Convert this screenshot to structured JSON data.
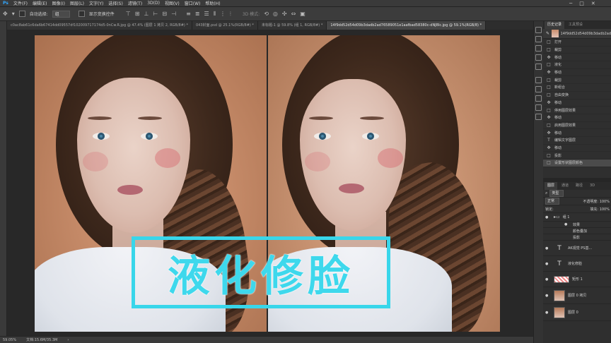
{
  "menu": [
    "文件(F)",
    "编辑(E)",
    "图像(I)",
    "图层(L)",
    "文字(Y)",
    "选择(S)",
    "滤镜(T)",
    "3D(D)",
    "视图(V)",
    "窗口(W)",
    "帮助(H)"
  ],
  "options_bar": {
    "auto_select_label": "自动选择:",
    "auto_select_value": "组",
    "transform_label": "显示变换控件",
    "mode_3d_label": "3D 模式:"
  },
  "tabs": [
    {
      "label": "c0ac8ab61c6da6b67414dd09557df102009717174d5-0nCw.R.jpg @ 47.4% (图层 1 拷贝 2, RGB/8#) *",
      "active": false
    },
    {
      "label": "043封面.psd @ 25.1%(RGB/8#) *",
      "active": false
    },
    {
      "label": "未标题-1 @ 59.8% (组 1, RGB/8#) *",
      "active": false
    },
    {
      "label": "14f9dd52d54d09b3dadb2ad76589051e1aafbad58380c-dNJ8Ic.jpg @ 59.1%(RGB/8) *",
      "active": true
    }
  ],
  "overlay_title": "液化修脸",
  "status": {
    "zoom": "59.05%",
    "doc": "文档:15.6M/35.3M"
  },
  "history_panel": {
    "tabs": [
      "历史记录",
      "工具预设"
    ],
    "snapshot": "14f9dd52d54d09b3dadb2ad5",
    "items": [
      {
        "icon": "□",
        "label": "打开"
      },
      {
        "icon": "□",
        "label": "裁剪"
      },
      {
        "icon": "✥",
        "label": "移动"
      },
      {
        "icon": "□",
        "label": "液化"
      },
      {
        "icon": "✥",
        "label": "移动"
      },
      {
        "icon": "□",
        "label": "裁剪"
      },
      {
        "icon": "□",
        "label": "新组合"
      },
      {
        "icon": "□",
        "label": "自由变换"
      },
      {
        "icon": "✥",
        "label": "移动"
      },
      {
        "icon": "□",
        "label": "停用图层效果"
      },
      {
        "icon": "✥",
        "label": "移动"
      },
      {
        "icon": "□",
        "label": "启用图层效果"
      },
      {
        "icon": "✥",
        "label": "移动"
      },
      {
        "icon": "T",
        "label": "编辑文字图层"
      },
      {
        "icon": "✥",
        "label": "移动"
      },
      {
        "icon": "□",
        "label": "投影"
      },
      {
        "icon": "□",
        "label": "设置形状图层颜色"
      }
    ]
  },
  "layers_panel": {
    "tabs": [
      "图层",
      "通道",
      "路径",
      "3D"
    ],
    "filter_label": "类型",
    "blend_mode": "正常",
    "opacity_label": "不透明度: 100%",
    "lock_label": "锁定:",
    "fill_label": "填充: 100%",
    "items": [
      {
        "name": "组 1",
        "type": "group"
      },
      {
        "name": "效果",
        "type": "sub"
      },
      {
        "name": "颜色叠加",
        "type": "sub"
      },
      {
        "name": "投影",
        "type": "sub"
      },
      {
        "name": "AK视觉  PS基...",
        "type": "text"
      },
      {
        "name": "液化修脸",
        "type": "text"
      },
      {
        "name": "矩形 1",
        "type": "shape"
      },
      {
        "name": "图层 0 拷贝",
        "type": "image"
      },
      {
        "name": "图层 0",
        "type": "image"
      }
    ]
  },
  "colors": {
    "title_accent": "#38d6ea",
    "panel_bg": "#2f2f2f",
    "app_bg": "#262626"
  }
}
